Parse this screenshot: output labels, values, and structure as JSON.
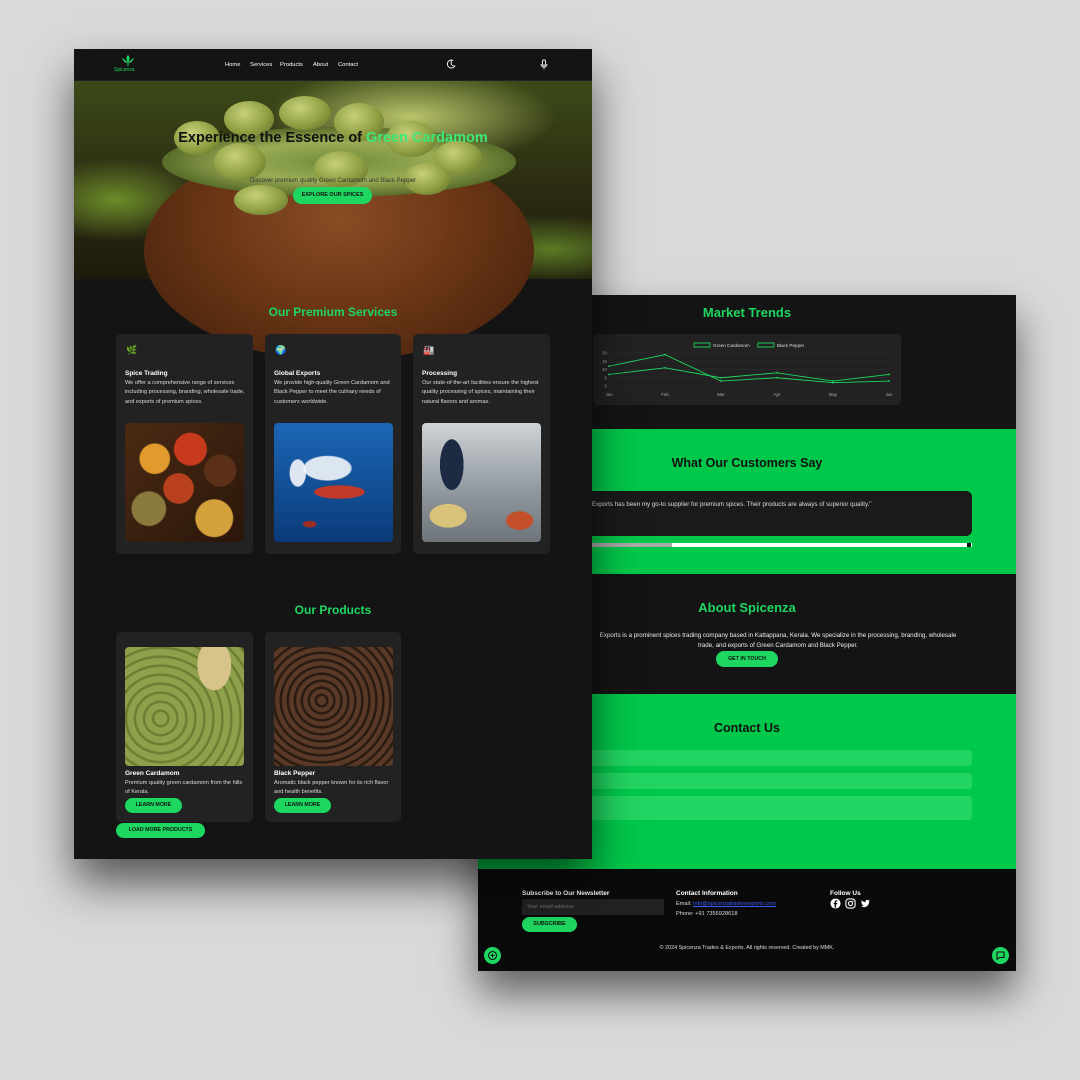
{
  "nav": {
    "logo": "Spicenza",
    "links": [
      "Home",
      "Services",
      "Products",
      "About",
      "Contact"
    ]
  },
  "hero": {
    "title_part1": "Experience the Essence of",
    "title_highlight": "Green Cardamom",
    "subtitle": "Discover premium quality Green Cardamom and Black Pepper",
    "cta": "EXPLORE OUR SPICES"
  },
  "services": {
    "title": "Our Premium Services",
    "items": [
      {
        "icon": "sprout-icon",
        "title": "Spice Trading",
        "desc": "We offer a comprehensive range of services including processing, branding, wholesale trade, and exports of premium spices."
      },
      {
        "icon": "globe-icon",
        "title": "Global Exports",
        "desc": "We provide high-quality Green Cardamom and Black Pepper to meet the culinary needs of customers worldwide."
      },
      {
        "icon": "factory-icon",
        "title": "Processing",
        "desc": "Our state-of-the-art facilities ensure the highest quality processing of spices, maintaining their natural flavors and aromas."
      }
    ]
  },
  "products": {
    "title": "Our Products",
    "items": [
      {
        "title": "Green Cardamom",
        "desc": "Premium quality green cardamom from the hills of Kerala.",
        "button": "LEARN MORE"
      },
      {
        "title": "Black Pepper",
        "desc": "Aromatic black pepper known for its rich flavor and health benefits.",
        "button": "LEARN MORE"
      }
    ],
    "load_more": "LOAD MORE PRODUCTS"
  },
  "market": {
    "title": "Market Trends"
  },
  "chart_data": {
    "type": "line",
    "categories": [
      "Jan",
      "Feb",
      "Mar",
      "Apr",
      "May",
      "Jun"
    ],
    "series": [
      {
        "name": "Green Cardamom",
        "values": [
          12,
          19,
          3,
          5,
          2,
          3
        ],
        "color": "#1ed760"
      },
      {
        "name": "Black Pepper",
        "values": [
          7,
          11,
          5,
          8,
          3,
          7
        ],
        "color": "#1ed760"
      }
    ],
    "yticks": [
      "20",
      "15",
      "10",
      "5",
      "0"
    ],
    "ylim": [
      0,
      20
    ],
    "legend": "top-center",
    "grid": true
  },
  "testimonials": {
    "title": "What Our Customers Say",
    "quote": "Exports has been my go-to supplier for premium spices. Their products are always of superior quality.\"",
    "progress": 0.21
  },
  "about": {
    "title": "About Spicenza",
    "text": "Exports is a prominent spices trading company based in Kattappana, Kerala. We specialize in the processing, branding, wholesale trade, and exports of Green Cardamom and Black Pepper.",
    "button": "GET IN TOUCH"
  },
  "contact": {
    "title": "Contact Us"
  },
  "footer": {
    "newsletter_title": "Subscribe to Our Newsletter",
    "email_placeholder": "Your email address",
    "subscribe": "SUBSCRIBE",
    "contact_title": "Contact Information",
    "email_label": "Email:",
    "email_value": "info@spicenzatradesexports.com",
    "phone": "Phone: +91 7356928618",
    "follow_title": "Follow Us",
    "social": [
      "facebook-icon",
      "instagram-icon",
      "twitter-icon"
    ],
    "copyright": "© 2024 Spicenza Trades & Exports. All rights reserved. Created by MMK."
  },
  "colors": {
    "accent": "#1ed760",
    "dark_bg": "#141414",
    "card_bg": "#222222",
    "green_band": "#00c84a"
  }
}
